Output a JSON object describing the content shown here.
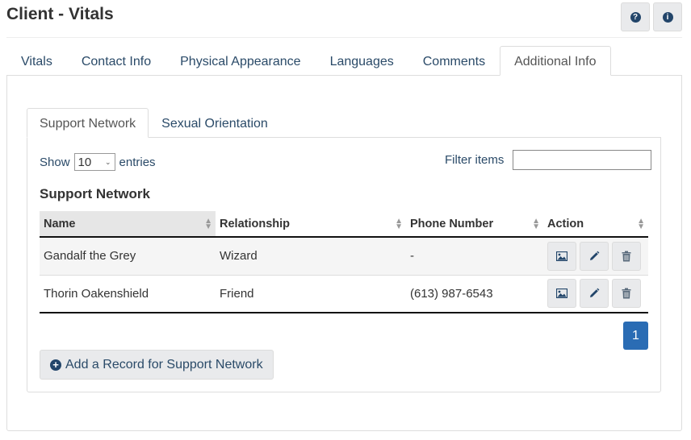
{
  "header": {
    "title": "Client - Vitals",
    "help_icon": "question-circle-icon",
    "info_icon": "info-circle-icon"
  },
  "main_tabs": [
    {
      "label": "Vitals",
      "active": false
    },
    {
      "label": "Contact Info",
      "active": false
    },
    {
      "label": "Physical Appearance",
      "active": false
    },
    {
      "label": "Languages",
      "active": false
    },
    {
      "label": "Comments",
      "active": false
    },
    {
      "label": "Additional Info",
      "active": true
    }
  ],
  "inner_tabs": [
    {
      "label": "Support Network",
      "active": true
    },
    {
      "label": "Sexual Orientation",
      "active": false
    }
  ],
  "length_control": {
    "show_label": "Show",
    "selected": "10",
    "entries_label": "entries"
  },
  "filter": {
    "label": "Filter items",
    "value": ""
  },
  "section_title": "Support Network",
  "table": {
    "columns": [
      "Name",
      "Relationship",
      "Phone Number",
      "Action"
    ],
    "sorted_column": "Name",
    "rows": [
      {
        "name": "Gandalf the Grey",
        "relationship": "Wizard",
        "phone": "-"
      },
      {
        "name": "Thorin Oakenshield",
        "relationship": "Friend",
        "phone": "(613) 987-6543"
      }
    ],
    "row_actions": [
      "image-icon",
      "pencil-icon",
      "trash-icon"
    ]
  },
  "pagination": {
    "current_page": "1"
  },
  "add_button": {
    "label": "Add a Record for Support Network",
    "icon": "plus-circle-icon"
  },
  "colors": {
    "link_text": "#2a4a68",
    "icon_dark": "#22456a",
    "page_active": "#2a6cb4",
    "button_bg": "#e9eaec"
  }
}
